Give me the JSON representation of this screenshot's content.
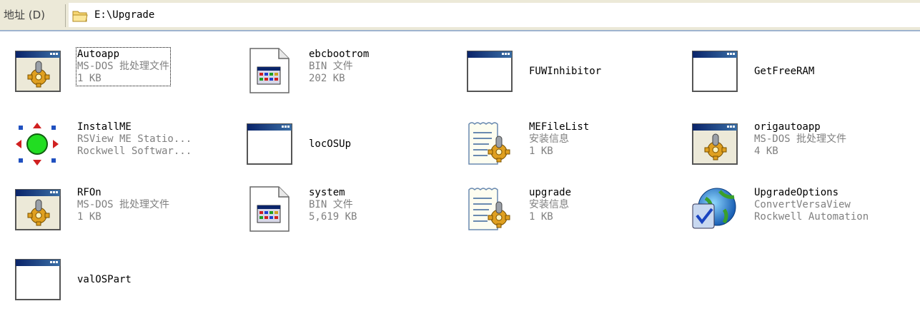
{
  "address": {
    "label": "地址 (D)",
    "path": "E:\\Upgrade"
  },
  "files": [
    {
      "name": "Autoapp",
      "line2": "MS-DOS 批处理文件",
      "line3": "1 KB",
      "icon": "batch-file-icon"
    },
    {
      "name": "ebcbootrom",
      "line2": "BIN 文件",
      "line3": "202 KB",
      "icon": "bin-file-icon"
    },
    {
      "name": "FUWInhibitor",
      "line2": "",
      "line3": "",
      "icon": "window-app-icon"
    },
    {
      "name": "GetFreeRAM",
      "line2": "",
      "line3": "",
      "icon": "window-app-icon"
    },
    {
      "name": "InstallME",
      "line2": "RSView ME Statio...",
      "line3": "Rockwell Softwar...",
      "icon": "installme-icon"
    },
    {
      "name": "locOSUp",
      "line2": "",
      "line3": "",
      "icon": "window-app-icon"
    },
    {
      "name": "MEFileList",
      "line2": "安装信息",
      "line3": "1 KB",
      "icon": "setup-info-icon"
    },
    {
      "name": "origautoapp",
      "line2": "MS-DOS 批处理文件",
      "line3": "4 KB",
      "icon": "batch-file-icon"
    },
    {
      "name": "RFOn",
      "line2": "MS-DOS 批处理文件",
      "line3": "1 KB",
      "icon": "batch-file-icon"
    },
    {
      "name": "system",
      "line2": "BIN 文件",
      "line3": "5,619 KB",
      "icon": "bin-file-icon"
    },
    {
      "name": "upgrade",
      "line2": "安装信息",
      "line3": "1 KB",
      "icon": "setup-info-icon"
    },
    {
      "name": "UpgradeOptions",
      "line2": "ConvertVersaView",
      "line3": "Rockwell Automation",
      "icon": "globe-app-icon"
    },
    {
      "name": "valOSPart",
      "line2": "",
      "line3": "",
      "icon": "window-app-icon"
    }
  ]
}
